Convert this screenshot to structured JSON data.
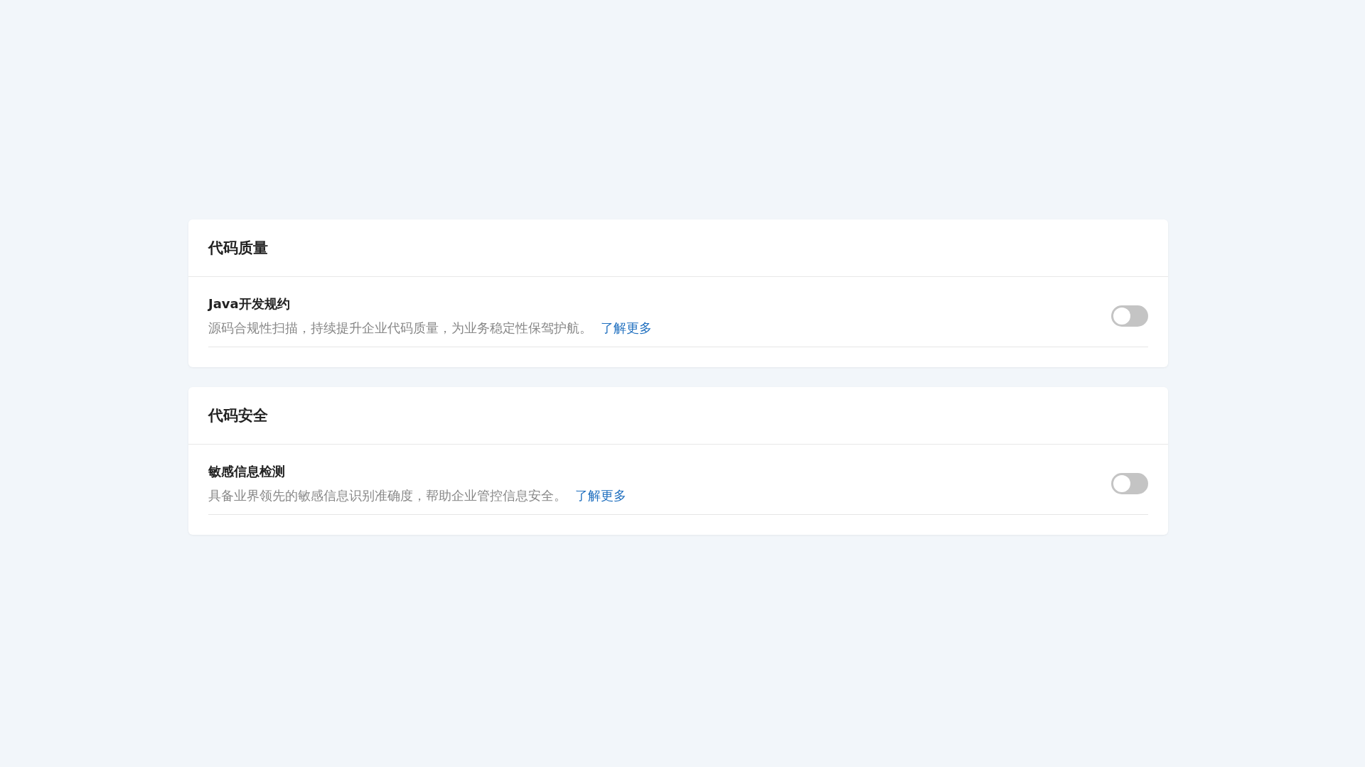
{
  "sections": [
    {
      "title": "代码质量",
      "items": [
        {
          "name": "Java开发规约",
          "description": "源码合规性扫描，持续提升企业代码质量，为业务稳定性保驾护航。",
          "link": "了解更多",
          "on": false
        }
      ]
    },
    {
      "title": "代码安全",
      "items": [
        {
          "name": "敏感信息检测",
          "description": "具备业界领先的敏感信息识别准确度，帮助企业管控信息安全。",
          "link": "了解更多",
          "on": false
        }
      ]
    }
  ]
}
